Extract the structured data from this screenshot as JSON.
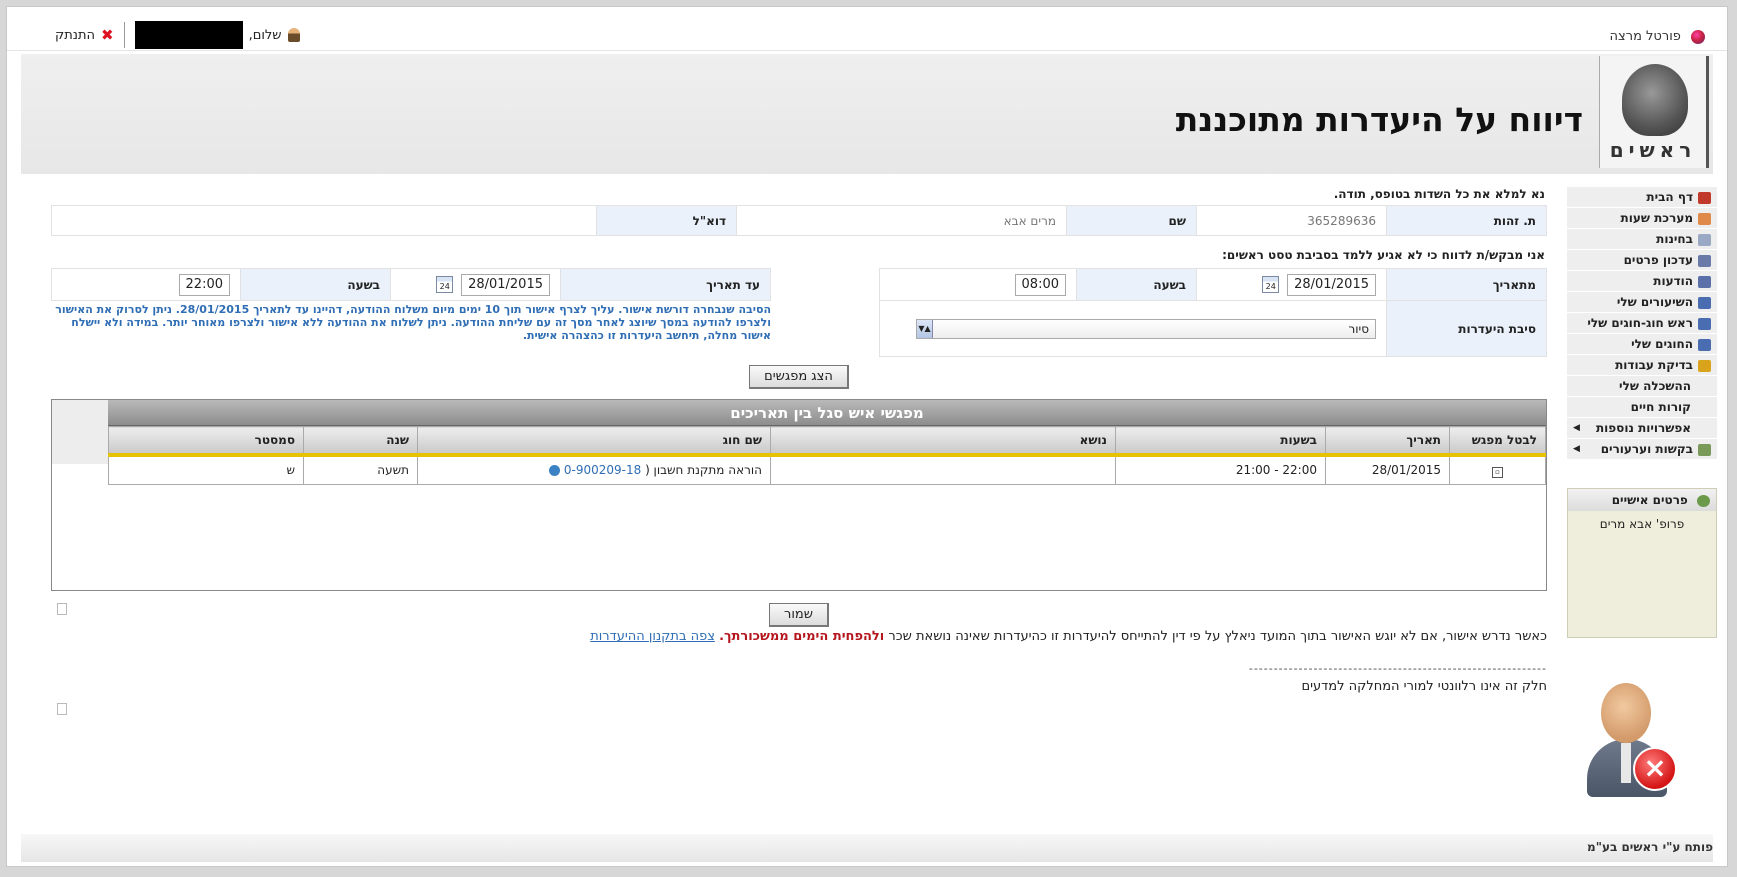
{
  "topbar": {
    "portal": "פורטל מרצה",
    "greeting": "שלום,",
    "logout": "התנתק"
  },
  "header": {
    "title": "דיווח על היעדרות מתוכננת",
    "logo_text": "ראשים"
  },
  "sidebar": {
    "items": [
      {
        "label": "דף הבית",
        "icon": "home-icon",
        "color": "#c0392b"
      },
      {
        "label": "מערכת שעות",
        "icon": "calendar-icon",
        "color": "#e08a4a"
      },
      {
        "label": "בחינות",
        "icon": "exam-icon",
        "color": "#9aa8c4"
      },
      {
        "label": "עדכון פרטים",
        "icon": "user-edit-icon",
        "color": "#6a7aa8"
      },
      {
        "label": "הודעות",
        "icon": "messages-icon",
        "color": "#5b6fa8"
      },
      {
        "label": "השיעורים שלי",
        "icon": "lessons-icon",
        "color": "#4a6cb0"
      },
      {
        "label": "ראש חוג-חוגים שלי",
        "icon": "department-icon",
        "color": "#4a6cb0"
      },
      {
        "label": "החוגים שלי",
        "icon": "courses-icon",
        "color": "#4a6cb0"
      },
      {
        "label": "בדיקת עבודות",
        "icon": "pencil-icon",
        "color": "#d9a31c"
      },
      {
        "label": "ההשכלה שלי",
        "icon": "",
        "color": ""
      },
      {
        "label": "קורות חיים",
        "icon": "",
        "color": ""
      },
      {
        "label": "אפשרויות נוספות",
        "icon": "",
        "color": "",
        "arrow": true
      },
      {
        "label": "בקשות וערעורים",
        "icon": "requests-icon",
        "color": "#7a9a5a",
        "arrow": true
      }
    ],
    "personal_title": "פרטים אישיים",
    "personal_name": "פרופ' אבא מרים"
  },
  "main": {
    "note": "נא למלא את כל השדות בטופס, תודה.",
    "id_label": "ת. זהות",
    "id_value": "365289636",
    "name_label": "שם",
    "name_value": "מרים אבא",
    "email_label": "דוא\"ל",
    "email_value": "",
    "request_text": "אני מבקש/ת לדווח כי לא אגיע ללמד בסביבת טסט ראשים:",
    "from_date_label": "מתאריך",
    "from_date": "28/01/2015",
    "from_time_label": "בשעה",
    "from_time": "08:00",
    "to_date_label": "עד תאריך",
    "to_date": "28/01/2015",
    "to_time_label": "בשעה",
    "to_time": "22:00",
    "reason_label": "סיבת היעדרות",
    "reason_value": "סיור",
    "reason_note": "הסיבה שנבחרה דורשת אישור. עליך לצרף אישור תוך 10 ימים מיום משלוח ההודעה, דהיינו עד לתאריך 28/01/2015. ניתן לסרוק את האישור ולצרפו להודעה במסך שיוצג לאחר מסך זה עם שליחת ההודעה. ניתן לשלוח את ההודעה ללא אישור ולצרפו מאוחר יותר. במידה ולא יישלח אישור מחלה, תיחשב היעדרות זו כהצהרה אישית.",
    "show_button": "הצג מפגשים",
    "meetings_title": "מפגשי איש סגל בין תאריכים",
    "columns": [
      "לבטל מפגש",
      "תאריך",
      "בשעות",
      "נושא",
      "שם חוג",
      "שנה",
      "סמסטר"
    ],
    "rows": [
      {
        "date": "28/01/2015",
        "hours": "22:00 - 21:00",
        "topic": "",
        "course": "הוראה מתקנת חשבון (",
        "course_code": "0-900209-18",
        "year": "תשעה",
        "semester": "ש"
      }
    ],
    "save_button": "שמור",
    "footer_text": "כאשר נדרש אישור, אם לא יוגש האישור בתוך המועד ניאלץ על פי דין להתייחס להיעדרות זו כהיעדרות שאינה נושאת שכר",
    "footer_red": "ולהפחית הימים ממשכורתך.",
    "footer_link": "צפה בתקנון ההיעדרות",
    "dashes": "------------------------------------------------------------",
    "footer_note": "חלק זה אינו רלוונטי למורי המחלקה למדעים",
    "credit": "פותח ע\"י ראשים בע\"מ"
  }
}
